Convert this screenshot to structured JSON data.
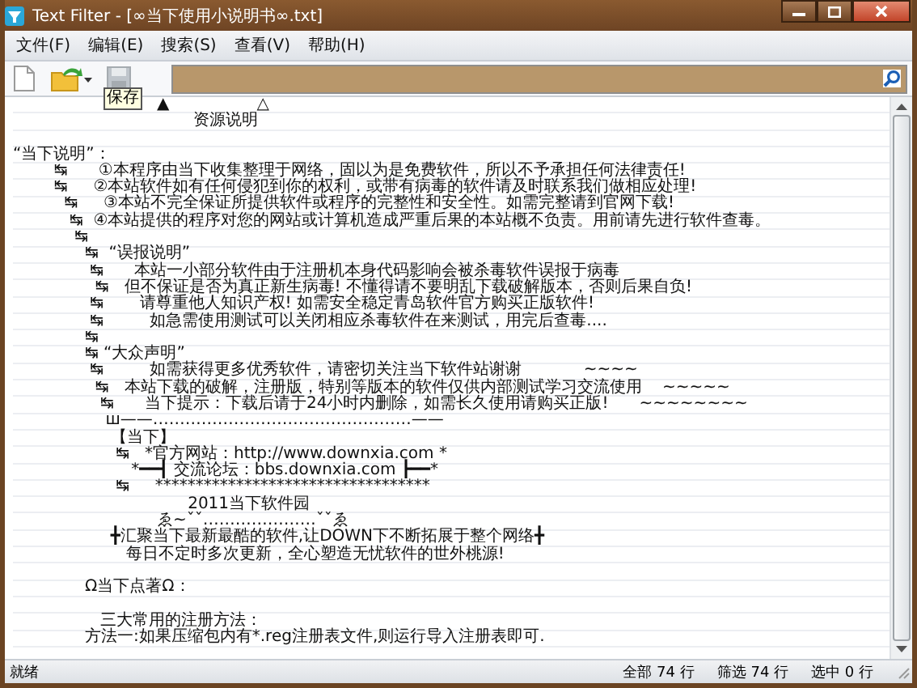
{
  "window": {
    "title": "Text Filter - [∞当下使用小说明书∞.txt]"
  },
  "menu": [
    {
      "label": "文件(F)"
    },
    {
      "label": "编辑(E)"
    },
    {
      "label": "搜索(S)"
    },
    {
      "label": "查看(V)"
    },
    {
      "label": "帮助(H)"
    }
  ],
  "toolbar": {
    "buttons": [
      {
        "kind": "new",
        "disabled": false
      },
      {
        "kind": "open",
        "disabled": false
      },
      {
        "kind": "save",
        "disabled": true
      }
    ],
    "tooltip": "保存"
  },
  "lines": [
    {
      "text": "                            ▲                 △"
    },
    {
      "text": "                                   资源说明"
    },
    {
      "kind": "blank"
    },
    {
      "text": "“当下说明”："
    },
    {
      "text": "        ↹      ①本程序由当下收集整理于网络，固以为是免费软件，所以不予承担任何法律责任!"
    },
    {
      "text": "        ↹     ②本站软件如有任何侵犯到你的权利，或带有病毒的软件请及时联系我们做相应处理!"
    },
    {
      "text": "          ↹     ③本站不完全保证所提供软件或程序的完整性和安全性。如需完整请到官网下载!"
    },
    {
      "text": "           ↹  ④本站提供的程序对您的网站或计算机造成严重后果的本站概不负责。用前请先进行软件查毒。"
    },
    {
      "text": "            ↹"
    },
    {
      "text": "              ↹  “误报说明”"
    },
    {
      "text": "               ↹      本站一小部分软件由于注册机本身代码影响会被杀毒软件误报于病毒"
    },
    {
      "text": "                ↹   但不保证是否为真正新生病毒! 不懂得请不要明乱下载破解版本，否则后果自负!"
    },
    {
      "text": "               ↹       请尊重他人知识产权! 如需安全稳定青岛软件官方购买正版软件!"
    },
    {
      "text": "               ↹         如急需使用测试可以关闭相应杀毒软件在来测试，用完后查毒...."
    },
    {
      "text": "              ↹"
    },
    {
      "text": "              ↹ “大众声明”"
    },
    {
      "text": "               ↹         如需获得更多优秀软件，请密切关注当下软件站谢谢            ~~~~"
    },
    {
      "text": "                ↹   本站下载的破解，注册版，特别等版本的软件仅供内部测试学习交流使用    ~~~~~"
    },
    {
      "text": "                 ↹      当下提示：下载后请于24小时内删除，如需长久使用请购买正版!      ~~~~~~~~"
    },
    {
      "text": "                  ш——…………………………………………——"
    },
    {
      "text": "                   【当下】"
    },
    {
      "text": "                    ↹   *官方网站：http://www.downxia.com *"
    },
    {
      "text": "                       *━━┫ 交流论坛：bbs.downxia.com ┣━━*"
    },
    {
      "text": "                    ↹     **********************************"
    },
    {
      "text": "                                  2011当下软件园"
    },
    {
      "text": "                            ゑ~ˇˇ…………………ˇˇゑ"
    },
    {
      "text": "                   ╋汇聚当下最新最酷的软件,让DOWN下不断拓展于整个网络╋"
    },
    {
      "text": "                      每日不定时多次更新，全心塑造无忧软件的世外桃源!"
    },
    {
      "kind": "blank"
    },
    {
      "text": "              Ω当下点著Ω："
    },
    {
      "kind": "blank"
    },
    {
      "text": "                 三大常用的注册方法："
    },
    {
      "text": "              方法一:如果压缩包内有*.reg注册表文件,则运行导入注册表即可."
    }
  ],
  "status_bar": {
    "message": "就绪",
    "total": "全部 74 行",
    "filtered": "筛选 74 行",
    "selected": "选中 0 行"
  }
}
